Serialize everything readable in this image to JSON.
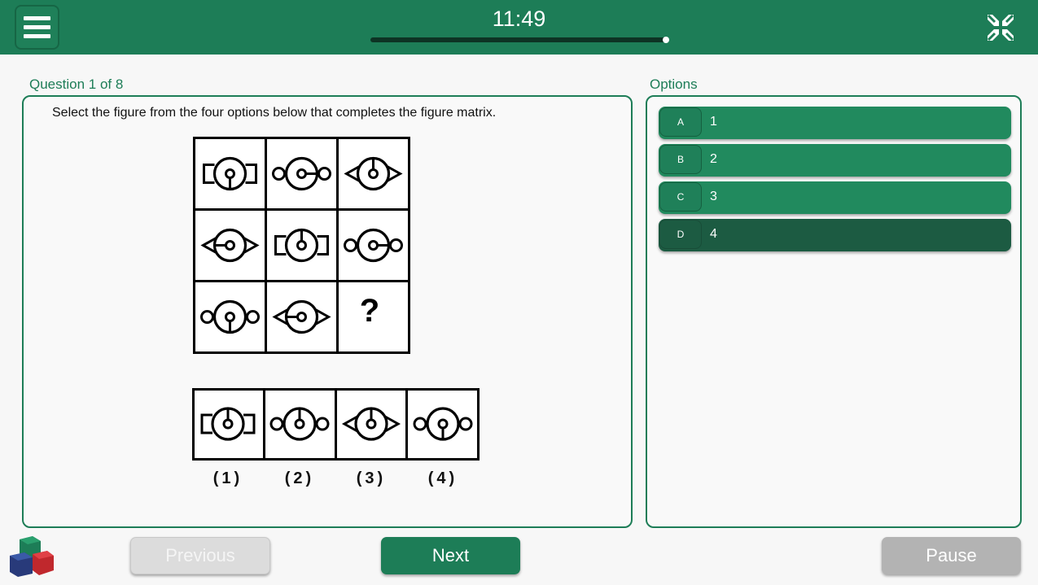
{
  "header": {
    "menu_icon": "hamburger-menu-icon",
    "timer": "11:49",
    "collapse_icon": "collapse-arrows-icon",
    "time_progress": 1.0
  },
  "question": {
    "label": "Question 1 of 8",
    "prompt": "Select the figure from the four options below that completes the figure matrix.",
    "missing_mark": "?",
    "answer_labels": [
      "(1)",
      "(2)",
      "(3)",
      "(4)"
    ]
  },
  "options": {
    "label": "Options",
    "items": [
      {
        "key": "A",
        "text": "1"
      },
      {
        "key": "B",
        "text": "2"
      },
      {
        "key": "C",
        "text": "3"
      },
      {
        "key": "D",
        "text": "4"
      }
    ],
    "selected": "D"
  },
  "footer": {
    "previous_label": "Previous",
    "next_label": "Next",
    "pause_label": "Pause",
    "logo_icon": "cubes-logo-icon"
  },
  "colors": {
    "primary": "#1d7d57",
    "option": "#218a5e",
    "option_selected": "#1c5b42",
    "disabled": "#dcdcdc",
    "pause": "#b3b3b3"
  }
}
